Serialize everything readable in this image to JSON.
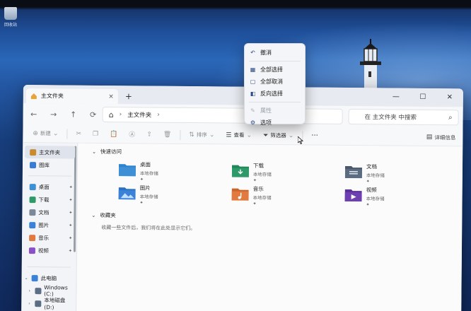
{
  "desktop": {
    "recycle_bin_label": "回收站"
  },
  "window": {
    "tab_title": "主文件夹",
    "tab_close": "×",
    "new_tab": "+",
    "controls": {
      "minimize": "—",
      "maximize": "☐",
      "close": "✕"
    }
  },
  "navbar": {
    "back": "←",
    "forward": "→",
    "up": "↑",
    "refresh": "⟳",
    "home_icon": "⌂",
    "chevron": "›",
    "address": "主文件夹",
    "address_chevron": "›",
    "search_placeholder": "在 主文件夹 中搜索",
    "search_icon": "⌕"
  },
  "cmdbar": {
    "new_label": "新建",
    "sort_label": "排序",
    "view_label": "查看",
    "filter_label": "筛选器",
    "more": "···",
    "details_label": "详细信息"
  },
  "sidebar": {
    "items": [
      {
        "label": "主文件夹",
        "icon": "home-icon",
        "color": "#c98b2e"
      },
      {
        "label": "图库",
        "icon": "gallery-icon",
        "color": "#3a7bd5"
      }
    ],
    "pinned": [
      {
        "label": "桌面",
        "icon": "desktop-icon",
        "color": "#3d8fd6"
      },
      {
        "label": "下载",
        "icon": "download-icon",
        "color": "#2e9a6a"
      },
      {
        "label": "文档",
        "icon": "documents-icon",
        "color": "#7a8899"
      },
      {
        "label": "图片",
        "icon": "pictures-icon",
        "color": "#3a82d8"
      },
      {
        "label": "音乐",
        "icon": "music-icon",
        "color": "#e07a3e"
      },
      {
        "label": "视频",
        "icon": "videos-icon",
        "color": "#8a4fc9"
      }
    ],
    "pin_glyph": "📌",
    "this_pc": "此电脑",
    "drives": [
      {
        "label": "Windows (C:)"
      },
      {
        "label": "本地磁盘 (D:)"
      }
    ]
  },
  "content": {
    "quick_access_title": "快速访问",
    "favorites_title": "收藏夹",
    "favorites_empty": "收藏一些文件后，我们将在此处显示它们。",
    "quick_items": [
      {
        "name": "桌面",
        "sub": "本地存储",
        "icon": "desktop-folder-icon",
        "color": "#3d8fd6"
      },
      {
        "name": "下载",
        "sub": "本地存储",
        "icon": "download-folder-icon",
        "color": "#2e9a6a"
      },
      {
        "name": "文档",
        "sub": "本地存储",
        "icon": "documents-folder-icon",
        "color": "#5b6b80"
      },
      {
        "name": "图片",
        "sub": "本地存储",
        "icon": "pictures-folder-icon",
        "color": "#3a82d8"
      },
      {
        "name": "音乐",
        "sub": "本地存储",
        "icon": "music-folder-icon",
        "color": "#e07a3e"
      },
      {
        "name": "视频",
        "sub": "本地存储",
        "icon": "videos-folder-icon",
        "color": "#6d3fb0"
      }
    ],
    "pin_glyph": "📌"
  },
  "context_menu": {
    "items": [
      {
        "label": "撤消",
        "icon": "undo-icon",
        "glyph": "↶",
        "disabled": false
      },
      {
        "label": "全部选择",
        "icon": "select-all-icon",
        "glyph": "▦",
        "disabled": false
      },
      {
        "label": "全部取消",
        "icon": "select-none-icon",
        "glyph": "▢",
        "disabled": false
      },
      {
        "label": "反向选择",
        "icon": "invert-selection-icon",
        "glyph": "◧",
        "disabled": false
      },
      {
        "label": "属性",
        "icon": "properties-icon",
        "glyph": "✎",
        "disabled": true
      },
      {
        "label": "选项",
        "icon": "options-icon",
        "glyph": "⚙",
        "disabled": false
      }
    ]
  },
  "colors": {
    "accent": "#2c4a85",
    "window_bg": "#f3f4f7",
    "desktop_blue": "#1f4f9a"
  }
}
